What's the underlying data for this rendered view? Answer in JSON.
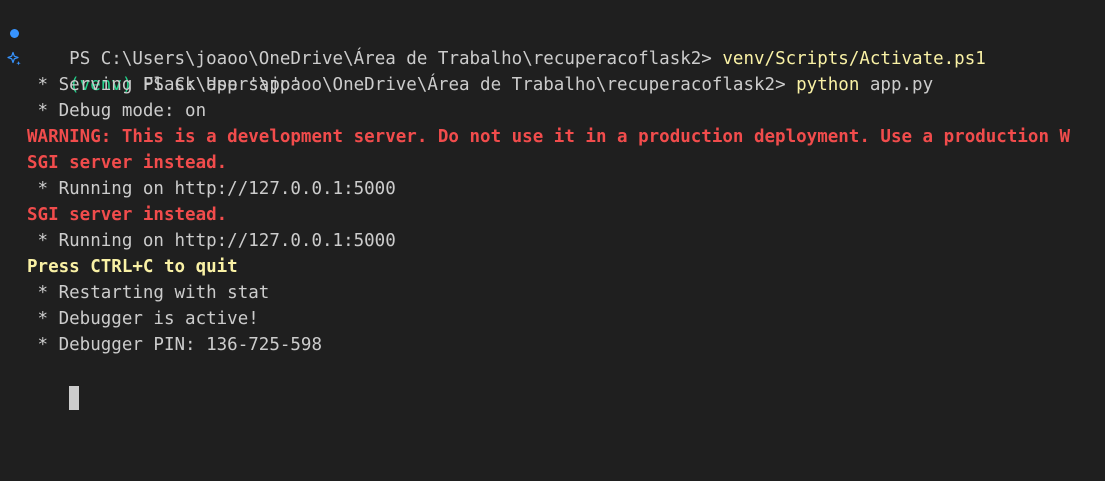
{
  "terminal": {
    "line1": {
      "prompt": "PS C:\\Users\\joaoo\\OneDrive\\Área de Trabalho\\recuperacoflask2> ",
      "command": "venv/Scripts/Activate.ps1"
    },
    "line2": {
      "venv": "(venv)",
      "prompt": " PS C:\\Users\\joaoo\\OneDrive\\Área de Trabalho\\recuperacoflask2> ",
      "command": "python",
      "args": " app.py"
    },
    "output": [
      " * Serving Flask app 'app'",
      " * Debug mode: on"
    ],
    "warning_1": "WARNING: This is a development server. Do not use it in a production deployment. Use a production W",
    "warning_2": "SGI server instead.",
    "running_1": " * Running on http://127.0.0.1:5000",
    "warning_3": "SGI server instead.",
    "running_2": " * Running on http://127.0.0.1:5000",
    "quit_hint": "Press CTRL+C to quit",
    "output_after": [
      " * Restarting with stat",
      " * Debugger is active!",
      " * Debugger PIN: 136-725-598"
    ]
  },
  "colors": {
    "background": "#1f1f1f",
    "text": "#cccccc",
    "command": "#f9f1a5",
    "venv": "#23d18b",
    "warning": "#f14c4c",
    "status_dot": "#3794ff"
  },
  "icons": {
    "line1": "status-dot-icon",
    "line2": "sparkle-icon"
  }
}
